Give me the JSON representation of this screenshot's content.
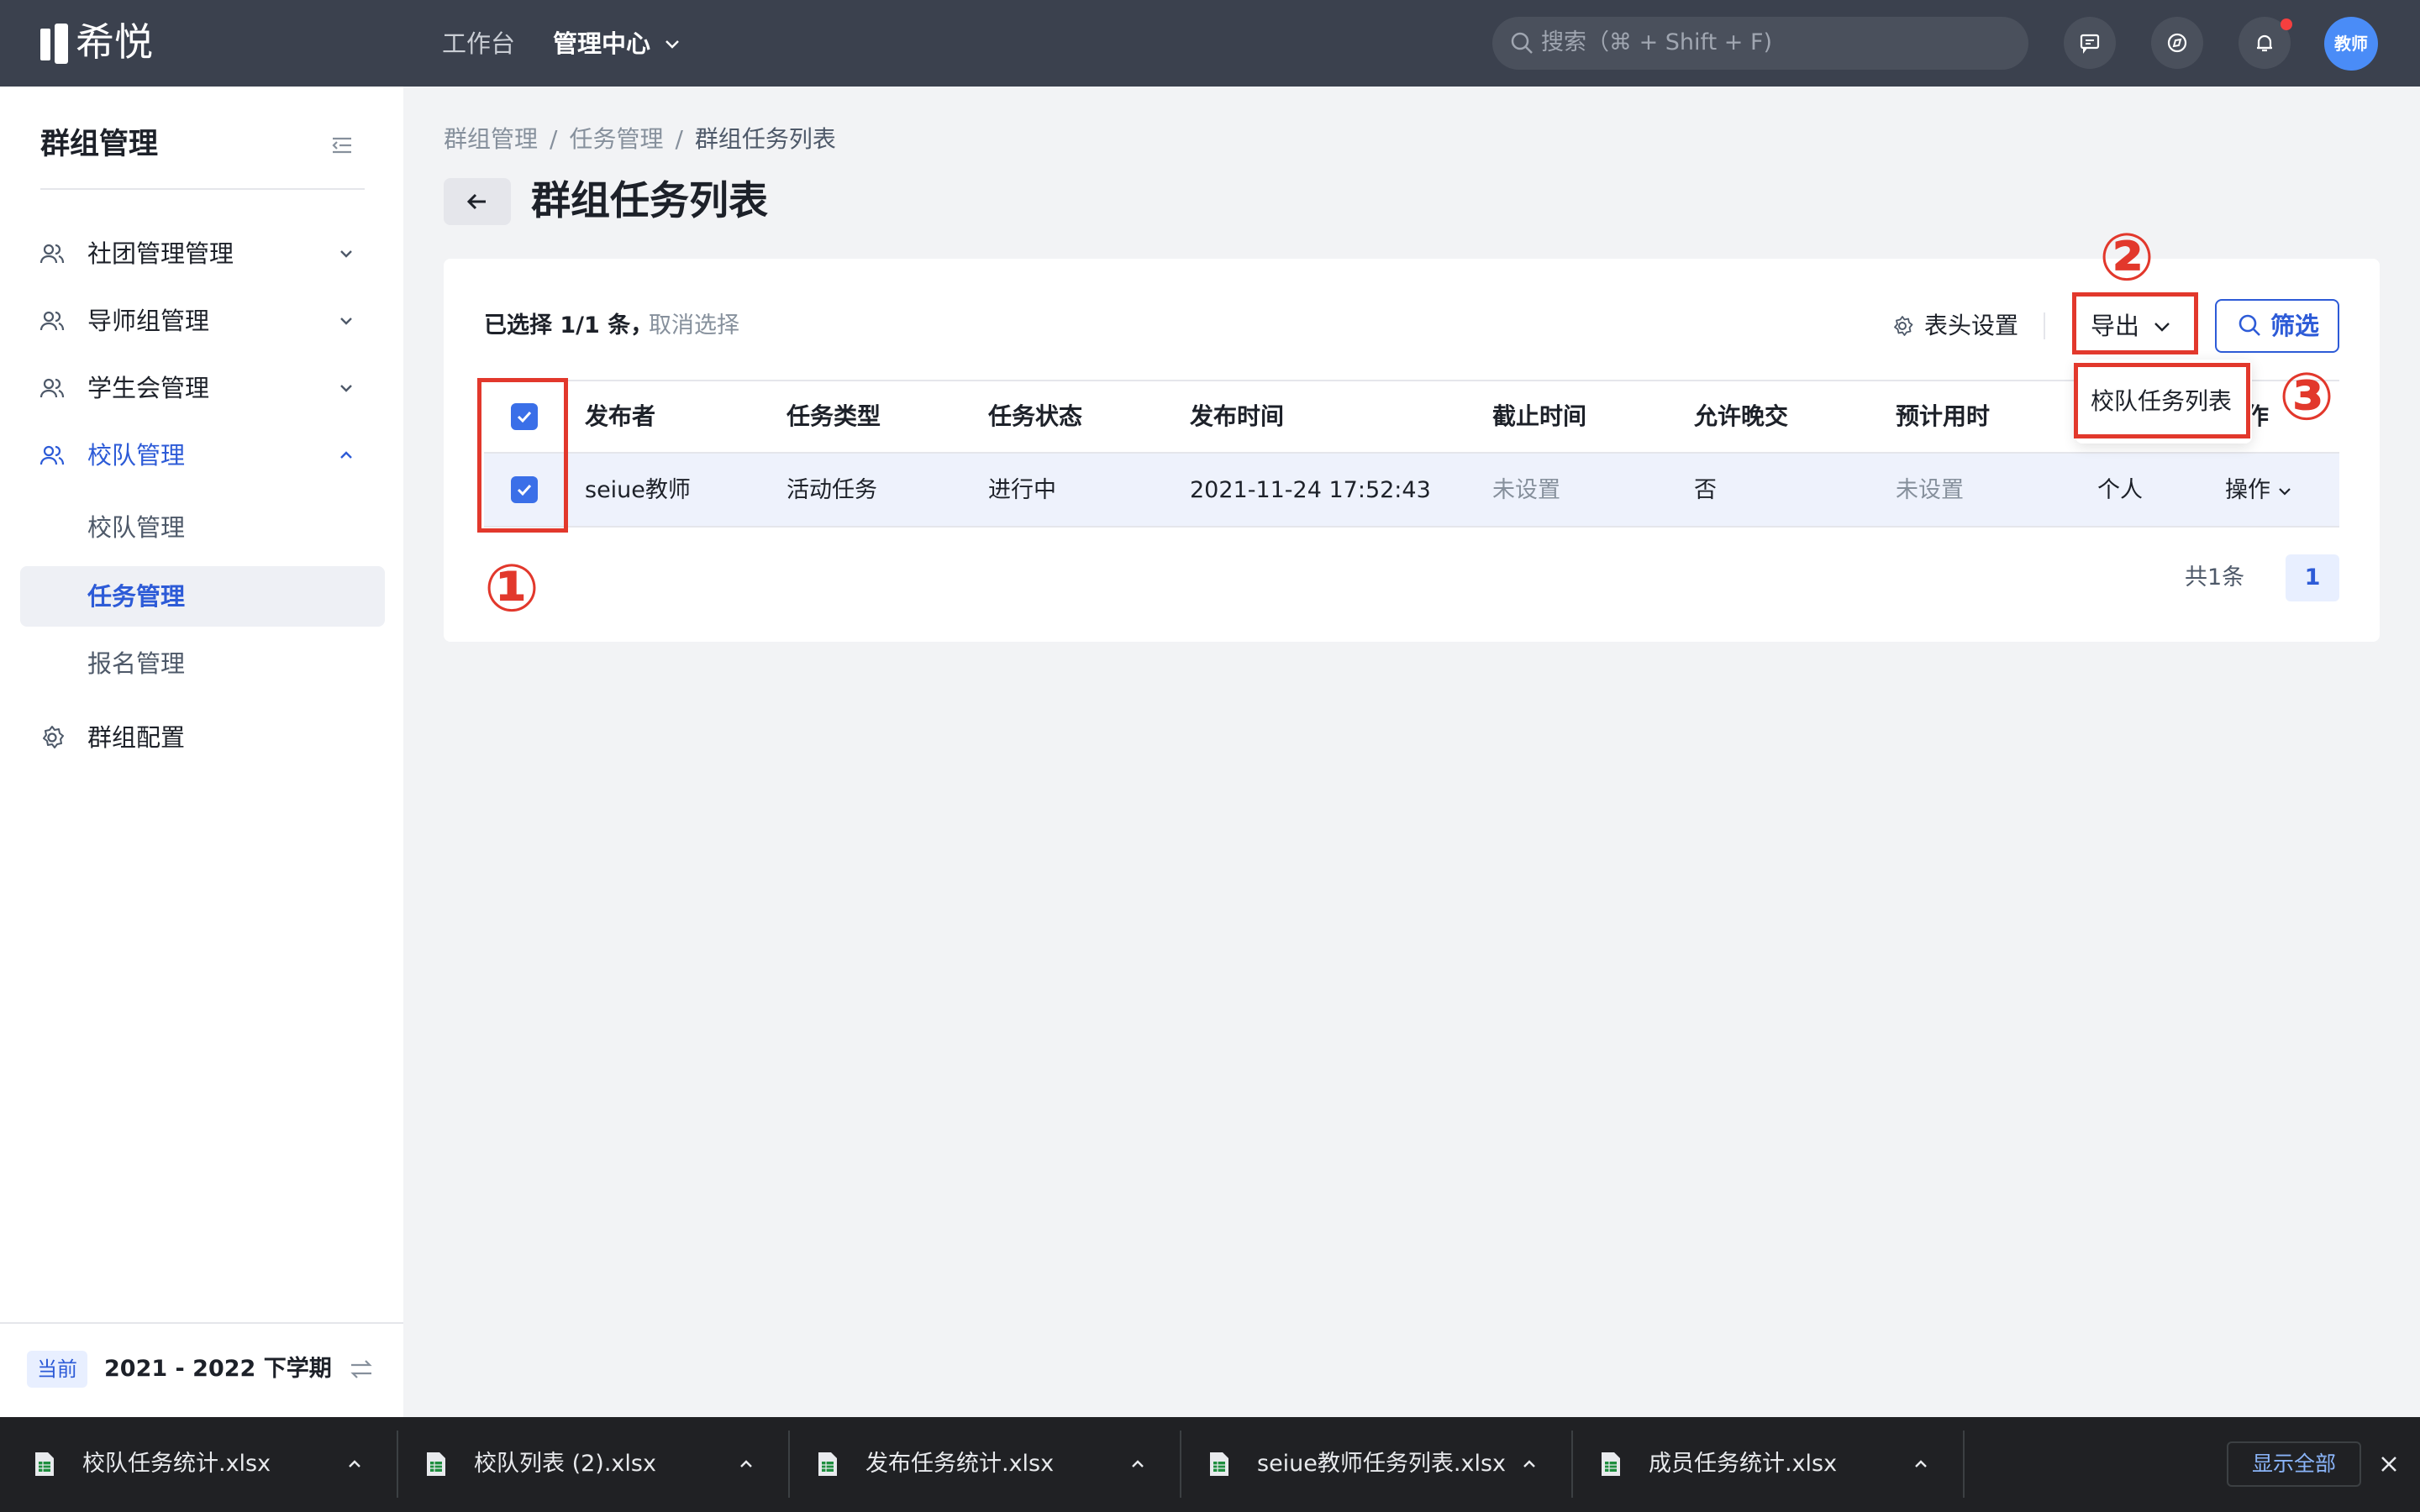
{
  "topbar": {
    "logo_text": "希悦",
    "nav": [
      "工作台",
      "管理中心"
    ],
    "search_placeholder": "搜索（⌘ + Shift + F)",
    "avatar_text": "教师"
  },
  "sidebar": {
    "title": "群组管理",
    "items": [
      {
        "label": "社团管理管理"
      },
      {
        "label": "导师组管理"
      },
      {
        "label": "学生会管理"
      },
      {
        "label": "校队管理"
      }
    ],
    "subitems": [
      {
        "label": "校队管理"
      },
      {
        "label": "任务管理"
      },
      {
        "label": "报名管理"
      }
    ],
    "config_label": "群组配置",
    "term_tag": "当前",
    "term_text": "2021 - 2022 下学期"
  },
  "breadcrumb": [
    "群组管理",
    "任务管理",
    "群组任务列表"
  ],
  "page_title": "群组任务列表",
  "toolbar": {
    "selection_text": "已选择 1/1 条，",
    "cancel_selection": "取消选择",
    "column_settings": "表头设置",
    "export": "导出",
    "filter": "筛选",
    "export_menu_item": "校队任务列表"
  },
  "table": {
    "headers": [
      "发布者",
      "任务类型",
      "任务状态",
      "发布时间",
      "截止时间",
      "允许晚交",
      "预计用时",
      "作"
    ],
    "rows": [
      [
        "seiue教师",
        "活动任务",
        "进行中",
        "2021-11-24 17:52:43",
        "未设置",
        "否",
        "未设置",
        "个人",
        "操作"
      ]
    ]
  },
  "pagination": {
    "total": "共1条",
    "current_page": "1"
  },
  "annotations": [
    "①",
    "②",
    "③"
  ],
  "downloads": {
    "files": [
      "校队任务统计.xlsx",
      "校队列表 (2).xlsx",
      "发布任务统计.xlsx",
      "seiue教师任务列表.xlsx",
      "成员任务统计.xlsx"
    ],
    "show_all": "显示全部"
  },
  "colors": {
    "topbar": "#3b414e",
    "accent": "#2d5bd7",
    "annotation": "#e2382c",
    "download_bar": "#202124"
  }
}
